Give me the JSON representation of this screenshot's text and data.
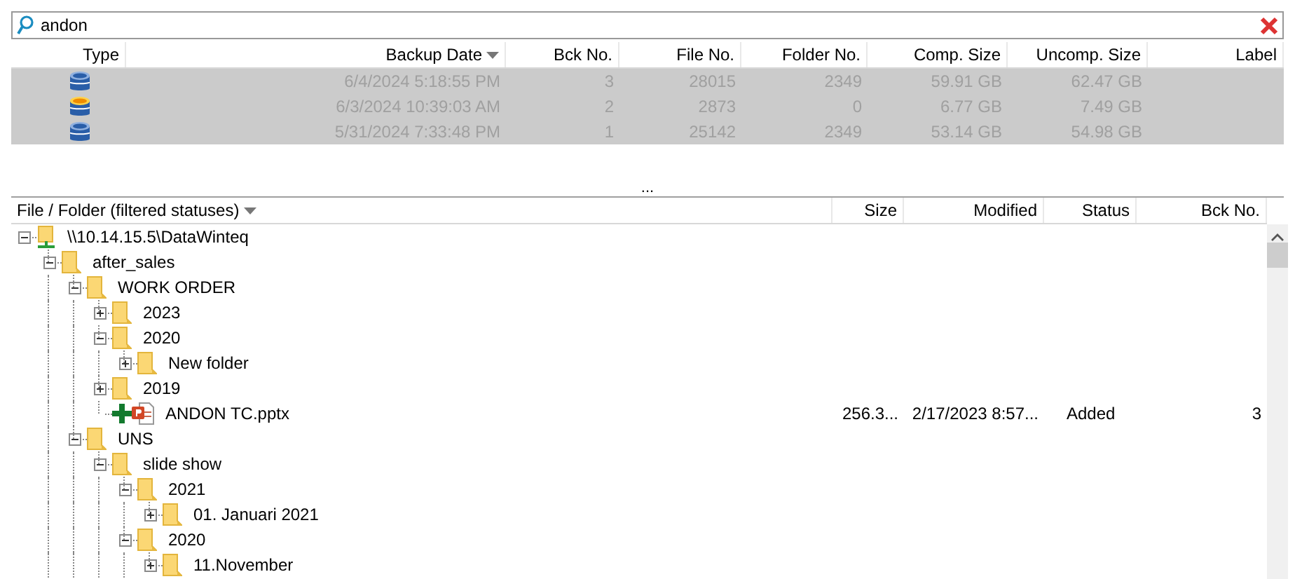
{
  "search": {
    "value": "andon"
  },
  "backups": {
    "columns": [
      {
        "label": "Type",
        "sorted": false
      },
      {
        "label": "Backup Date",
        "sorted": true
      },
      {
        "label": "Bck No.",
        "sorted": false
      },
      {
        "label": "File No.",
        "sorted": false
      },
      {
        "label": "Folder No.",
        "sorted": false
      },
      {
        "label": "Comp. Size",
        "sorted": false
      },
      {
        "label": "Uncomp. Size",
        "sorted": false
      },
      {
        "label": "Label",
        "sorted": false
      }
    ],
    "rows": [
      {
        "kind": "full",
        "backup_date": "6/4/2024 5:18:55 PM",
        "bck_no": "3",
        "file_no": "28015",
        "folder_no": "2349",
        "comp_size": "59.91 GB",
        "uncomp_size": "62.47 GB",
        "selected": true
      },
      {
        "kind": "incremental",
        "backup_date": "6/3/2024 10:39:03 AM",
        "bck_no": "2",
        "file_no": "2873",
        "folder_no": "0",
        "comp_size": "6.77 GB",
        "uncomp_size": "7.49 GB",
        "selected": true
      },
      {
        "kind": "full",
        "backup_date": "5/31/2024 7:33:48 PM",
        "bck_no": "1",
        "file_no": "25142",
        "folder_no": "2349",
        "comp_size": "53.14 GB",
        "uncomp_size": "54.98 GB",
        "selected": true
      }
    ]
  },
  "splitter": "...",
  "files": {
    "columns": [
      "File / Folder (filtered statuses)",
      "Size",
      "Modified",
      "Status",
      "Bck No."
    ],
    "tree": [
      {
        "kind": "share",
        "name": "\\\\10.14.15.5\\DataWinteq",
        "expanded": true,
        "children": [
          {
            "kind": "folder",
            "name": "after_sales",
            "expanded": true,
            "children": [
              {
                "kind": "folder",
                "name": "WORK ORDER",
                "expanded": true,
                "children": [
                  {
                    "kind": "folder",
                    "name": "2023",
                    "expanded": false
                  },
                  {
                    "kind": "folder",
                    "name": "2020",
                    "expanded": true,
                    "children": [
                      {
                        "kind": "folder",
                        "name": "New folder",
                        "expanded": false
                      }
                    ]
                  },
                  {
                    "kind": "folder",
                    "name": "2019",
                    "expanded": false
                  },
                  {
                    "kind": "file",
                    "name": "ANDON TC.pptx",
                    "added": true,
                    "size": "256.3...",
                    "modified": "2/17/2023 8:57...",
                    "status": "Added",
                    "bck_no": "3"
                  }
                ]
              },
              {
                "kind": "folder",
                "name": "UNS",
                "expanded": true,
                "children": [
                  {
                    "kind": "folder",
                    "name": "slide show",
                    "expanded": true,
                    "children": [
                      {
                        "kind": "folder",
                        "name": "2021",
                        "expanded": true,
                        "children": [
                          {
                            "kind": "folder",
                            "name": "01. Januari 2021",
                            "expanded": false
                          }
                        ]
                      },
                      {
                        "kind": "folder",
                        "name": "2020",
                        "expanded": true,
                        "children": [
                          {
                            "kind": "folder",
                            "name": "11.November",
                            "expanded": false
                          }
                        ]
                      }
                    ]
                  }
                ]
              }
            ]
          }
        ]
      }
    ]
  }
}
